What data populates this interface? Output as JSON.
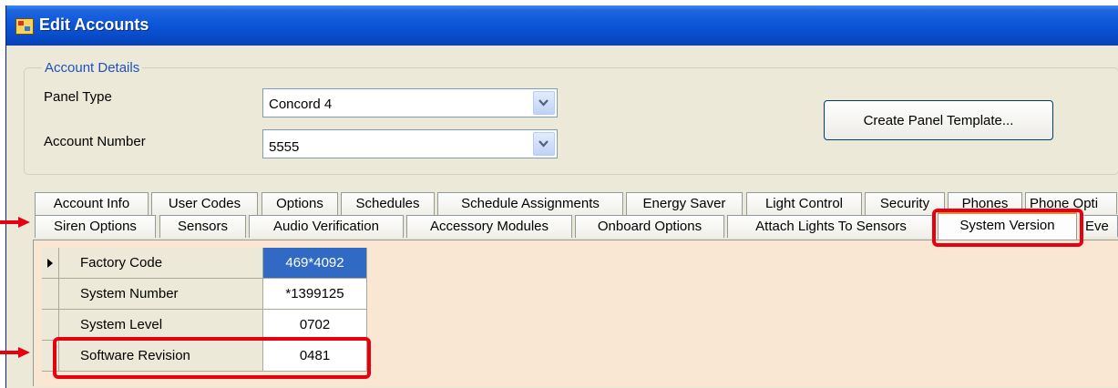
{
  "window": {
    "title": "Edit Accounts"
  },
  "account_details": {
    "legend": "Account Details",
    "panel_type_label": "Panel Type",
    "panel_type_value": "Concord 4",
    "account_number_label": "Account Number",
    "account_number_value": "5555",
    "create_template_label": "Create Panel Template..."
  },
  "tabs_row1": [
    "Account Info",
    "User Codes",
    "Options",
    "Schedules",
    "Schedule Assignments",
    "Energy Saver",
    "Light Control",
    "Security",
    "Phones",
    "Phone Opti"
  ],
  "tabs_row2": [
    "Siren Options",
    "Sensors",
    "Audio Verification",
    "Accessory Modules",
    "Onboard Options",
    "Attach Lights To Sensors",
    "System Version",
    "Eve"
  ],
  "active_tab": "System Version",
  "grid": {
    "rows": [
      {
        "name": "Factory Code",
        "value": "469*4092"
      },
      {
        "name": "System Number",
        "value": "*1399125"
      },
      {
        "name": "System Level",
        "value": "0702"
      },
      {
        "name": "Software Revision",
        "value": "0481"
      }
    ]
  },
  "colors": {
    "highlight": "#e8000f",
    "titlebar": "#0a55d8",
    "selected_cell": "#316ac5",
    "panel_bg": "#f9e6d3"
  }
}
